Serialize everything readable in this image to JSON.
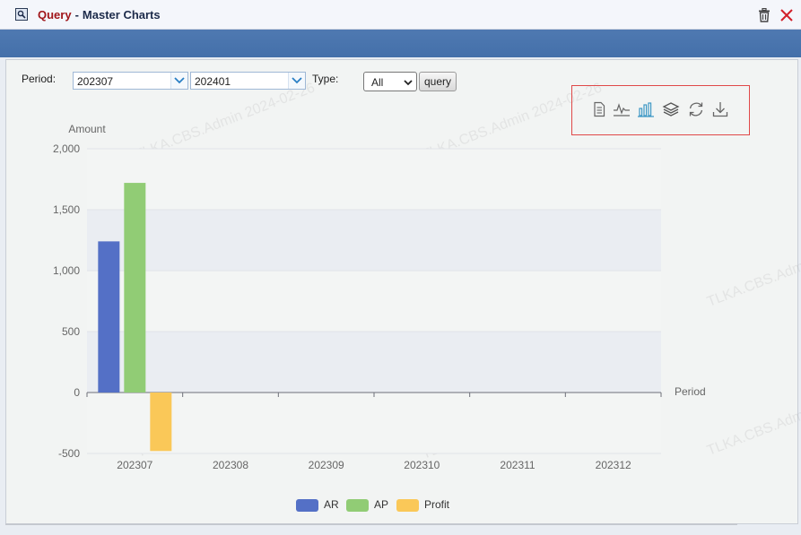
{
  "window": {
    "title_part1": "Query",
    "title_separator": "-",
    "title_part2": "Master Charts"
  },
  "filters": {
    "period_label": "Period:",
    "period_from": "202307",
    "period_to": "202401",
    "type_label": "Type:",
    "type_value": "All",
    "query_label": "query"
  },
  "toolbox_icons": [
    "data-view-icon",
    "line-chart-icon",
    "bar-chart-icon",
    "stack-icon",
    "restore-icon",
    "download-icon"
  ],
  "watermark_text": "TLKA.CBS.Admin 2024-02-26",
  "colors": {
    "AR": "#5470c6",
    "AP": "#91cc75",
    "Profit": "#fac858",
    "active_tool": "#3e98c5",
    "highlight_box": "#e04848"
  },
  "chart_data": {
    "type": "bar",
    "ylabel": "Amount",
    "xlabel": "Period",
    "categories": [
      "202307",
      "202308",
      "202309",
      "202310",
      "202311",
      "202312"
    ],
    "series": [
      {
        "name": "AR",
        "values": [
          1240,
          0,
          0,
          0,
          0,
          0
        ]
      },
      {
        "name": "AP",
        "values": [
          1720,
          0,
          0,
          0,
          0,
          0
        ]
      },
      {
        "name": "Profit",
        "values": [
          -480,
          0,
          0,
          0,
          0,
          0
        ]
      }
    ],
    "ylim": [
      -500,
      2000
    ],
    "yticks": [
      -500,
      0,
      500,
      1000,
      1500,
      2000
    ],
    "ytick_labels": [
      "-500",
      "0",
      "500",
      "1,000",
      "1,500",
      "2,000"
    ],
    "grid": true,
    "legend": "bottom-center"
  }
}
